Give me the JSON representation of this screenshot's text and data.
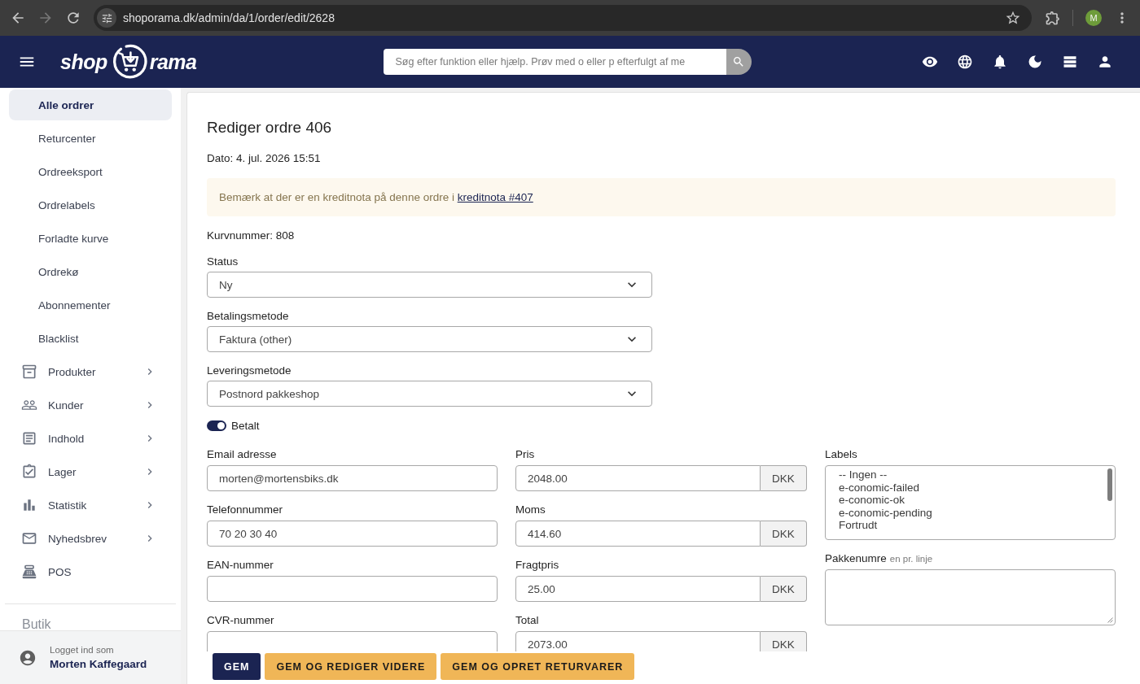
{
  "browser": {
    "nav": [
      {
        "kind": "back",
        "disabled": false
      },
      {
        "kind": "forward",
        "disabled": true
      },
      {
        "kind": "reload",
        "disabled": false
      }
    ],
    "url": "shoporama.dk/admin/da/1/order/edit/2628",
    "profile_initial": "M"
  },
  "header": {
    "logo": [
      "shop",
      "rama"
    ],
    "search": {
      "placeholder": "Søg efter funktion eller hjælp. Prøv med o eller p efterfulgt af me"
    }
  },
  "sidebar": {
    "items": [
      {
        "kind": "sub",
        "label": "Alle ordrer",
        "selected": true
      },
      {
        "kind": "sub",
        "label": "Returcenter",
        "selected": false
      },
      {
        "kind": "sub",
        "label": "Ordreeksport",
        "selected": false
      },
      {
        "kind": "sub",
        "label": "Ordrelabels",
        "selected": false
      },
      {
        "kind": "sub",
        "label": "Forladte kurve",
        "selected": false
      },
      {
        "kind": "sub",
        "label": "Ordrekø",
        "selected": false
      },
      {
        "kind": "sub",
        "label": "Abonnementer",
        "selected": false
      },
      {
        "kind": "sub",
        "label": "Blacklist",
        "selected": false
      },
      {
        "kind": "group",
        "label": "Produkter",
        "selected": false
      },
      {
        "kind": "group",
        "label": "Kunder",
        "selected": false
      },
      {
        "kind": "group",
        "label": "Indhold",
        "selected": false
      },
      {
        "kind": "group",
        "label": "Lager",
        "selected": false
      },
      {
        "kind": "group",
        "label": "Statistik",
        "selected": false
      },
      {
        "kind": "group",
        "label": "Nyhedsbrev",
        "selected": false
      },
      {
        "kind": "link",
        "label": "POS",
        "selected": false
      }
    ],
    "section": "Butik",
    "footer": {
      "caption": "Logget ind som",
      "user": "Morten Kaffegaard"
    }
  },
  "page": {
    "title": "Rediger ordre 406",
    "date": "Dato: 4. jul. 2026 15:51",
    "notice": {
      "text": "Bemærk at der er en kreditnota på denne ordre i",
      "link": "kreditnota #407"
    },
    "basket": "Kurvnummer: 808",
    "selects": [
      {
        "label": "Status",
        "value": "Ny"
      },
      {
        "label": "Betalingsmetode",
        "value": "Faktura (other)"
      },
      {
        "label": "Leveringsmetode",
        "value": "Postnord pakkeshop"
      }
    ],
    "paid_toggle": {
      "label": "Betalt",
      "on": true
    },
    "contact_fields": [
      {
        "label": "Email adresse",
        "value": "morten@mortensbiks.dk"
      },
      {
        "label": "Telefonnummer",
        "value": "70 20 30 40"
      },
      {
        "label": "EAN-nummer"
      },
      {
        "label": "CVR-nummer"
      }
    ],
    "amount_fields": [
      {
        "label": "Pris",
        "value": "2048.00",
        "unit": "DKK"
      },
      {
        "label": "Moms",
        "value": "414.60",
        "unit": "DKK"
      },
      {
        "label": "Fragtpris",
        "value": "25.00",
        "unit": "DKK"
      },
      {
        "label": "Total",
        "value": "2073.00",
        "unit": "DKK"
      }
    ],
    "labels": {
      "label": "Labels",
      "options": [
        {
          "label": "-- Ingen --",
          "selected": false
        },
        {
          "label": "e-conomic-failed",
          "selected": false
        },
        {
          "label": "e-conomic-ok",
          "selected": false
        },
        {
          "label": "e-conomic-pending",
          "selected": false
        },
        {
          "label": "Fortrudt",
          "selected": false
        }
      ]
    },
    "package_numbers": {
      "label": "Pakkenumre",
      "hint": "en pr. linje"
    },
    "buttons": [
      {
        "kind": "primary",
        "label": "GEM"
      },
      {
        "kind": "secondary",
        "label": "GEM OG REDIGER VIDERE"
      },
      {
        "kind": "secondary",
        "label": "GEM OG OPRET RETURVARER"
      }
    ]
  }
}
